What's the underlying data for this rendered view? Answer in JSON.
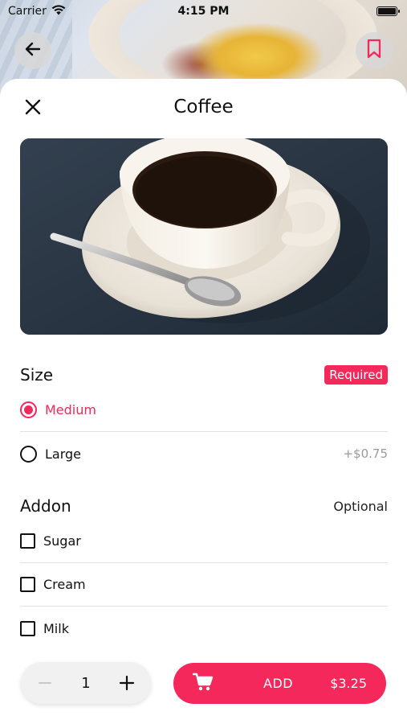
{
  "status_bar": {
    "carrier": "Carrier",
    "time": "4:15 PM"
  },
  "sheet": {
    "title": "Coffee"
  },
  "size_section": {
    "title": "Size",
    "badge": "Required",
    "options": [
      {
        "label": "Medium",
        "price": "",
        "selected": true
      },
      {
        "label": "Large",
        "price": "+$0.75",
        "selected": false
      }
    ]
  },
  "addon_section": {
    "title": "Addon",
    "badge": "Optional",
    "options": [
      {
        "label": "Sugar",
        "checked": false
      },
      {
        "label": "Cream",
        "checked": false
      },
      {
        "label": "Milk",
        "checked": false
      }
    ]
  },
  "order": {
    "quantity": "1",
    "add_label": "ADD",
    "price": "$3.25"
  },
  "icons": {
    "back": "arrow-left-icon",
    "bookmark": "bookmark-icon",
    "close": "close-icon",
    "cart": "cart-icon",
    "minus": "minus-icon",
    "plus": "plus-icon",
    "wifi": "wifi-icon",
    "battery": "battery-icon"
  },
  "colors": {
    "accent": "#f4285a",
    "muted": "#9a9a9a"
  }
}
